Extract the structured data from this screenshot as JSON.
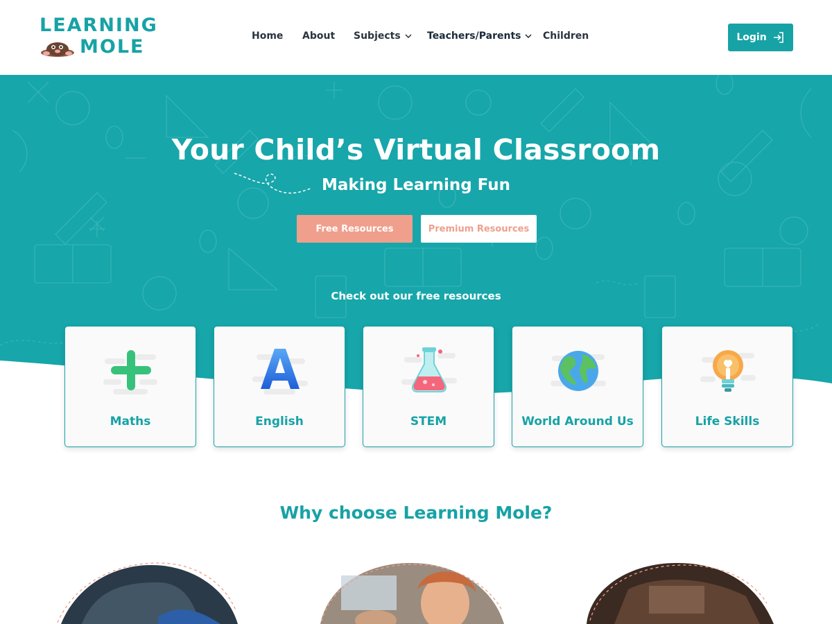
{
  "brand": {
    "line1": "LEARNING",
    "line2": "MOLE"
  },
  "nav": {
    "items": [
      {
        "label": "Home",
        "dropdown": false
      },
      {
        "label": "About",
        "dropdown": false
      },
      {
        "label": "Subjects",
        "dropdown": true
      },
      {
        "label": "Teachers/Parents",
        "dropdown": true
      },
      {
        "label": "Children",
        "dropdown": false
      }
    ],
    "login_label": "Login"
  },
  "hero": {
    "title": "Your Child’s Virtual Classroom",
    "subtitle": "Making Learning Fun",
    "free_button": "Free Resources",
    "premium_button": "Premium Resources",
    "note": "Check out our free resources"
  },
  "cards": [
    {
      "label": "Maths",
      "icon": "plus-icon"
    },
    {
      "label": "English",
      "icon": "letter-a-icon"
    },
    {
      "label": "STEM",
      "icon": "flask-icon"
    },
    {
      "label": "World Around Us",
      "icon": "globe-icon"
    },
    {
      "label": "Life Skills",
      "icon": "lightbulb-icon"
    }
  ],
  "why": {
    "title": "Why choose Learning Mole?"
  },
  "colors": {
    "teal": "#17a2a6",
    "coral": "#ef9f8c",
    "text_dark": "#2a3340"
  }
}
